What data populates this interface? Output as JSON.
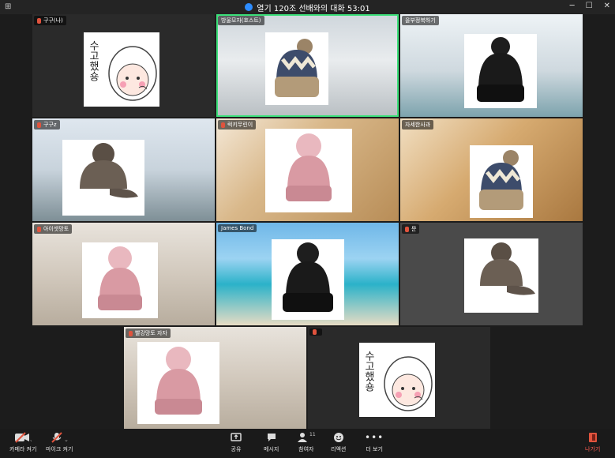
{
  "window": {
    "title": "열기 120조 선배와의 대화 53:01"
  },
  "tiles": [
    {
      "name": "구구(나)"
    },
    {
      "name": "방울모자(호스트)"
    },
    {
      "name": "을부정복하기"
    },
    {
      "name": "구구z"
    },
    {
      "name": "럭키무린이"
    },
    {
      "name": "자세한사과"
    },
    {
      "name": "아이셋망토"
    },
    {
      "name": "James Bond"
    },
    {
      "name": "문"
    },
    {
      "name": "빨강망토 자자"
    },
    {
      "name": ""
    }
  ],
  "sticker": {
    "text": "수고했숑"
  },
  "toolbar": {
    "camera": "카메라 켜기",
    "mic": "마이크 켜기",
    "share": "공유",
    "chat": "메시지",
    "participants": "참여자",
    "participants_count": "11",
    "reactions": "리액션",
    "more": "더 보기",
    "leave": "나가기"
  },
  "colors": {
    "active_speaker": "#3ce07a",
    "accent": "#2d8cff",
    "leave": "#ff5d52"
  },
  "icons": [
    "grid-icon",
    "shield-icon",
    "minimize-icon",
    "maximize-icon",
    "close-icon",
    "camera-icon",
    "mic-icon",
    "share-icon",
    "chat-icon",
    "participants-icon",
    "reactions-icon",
    "more-icon",
    "leave-icon"
  ]
}
